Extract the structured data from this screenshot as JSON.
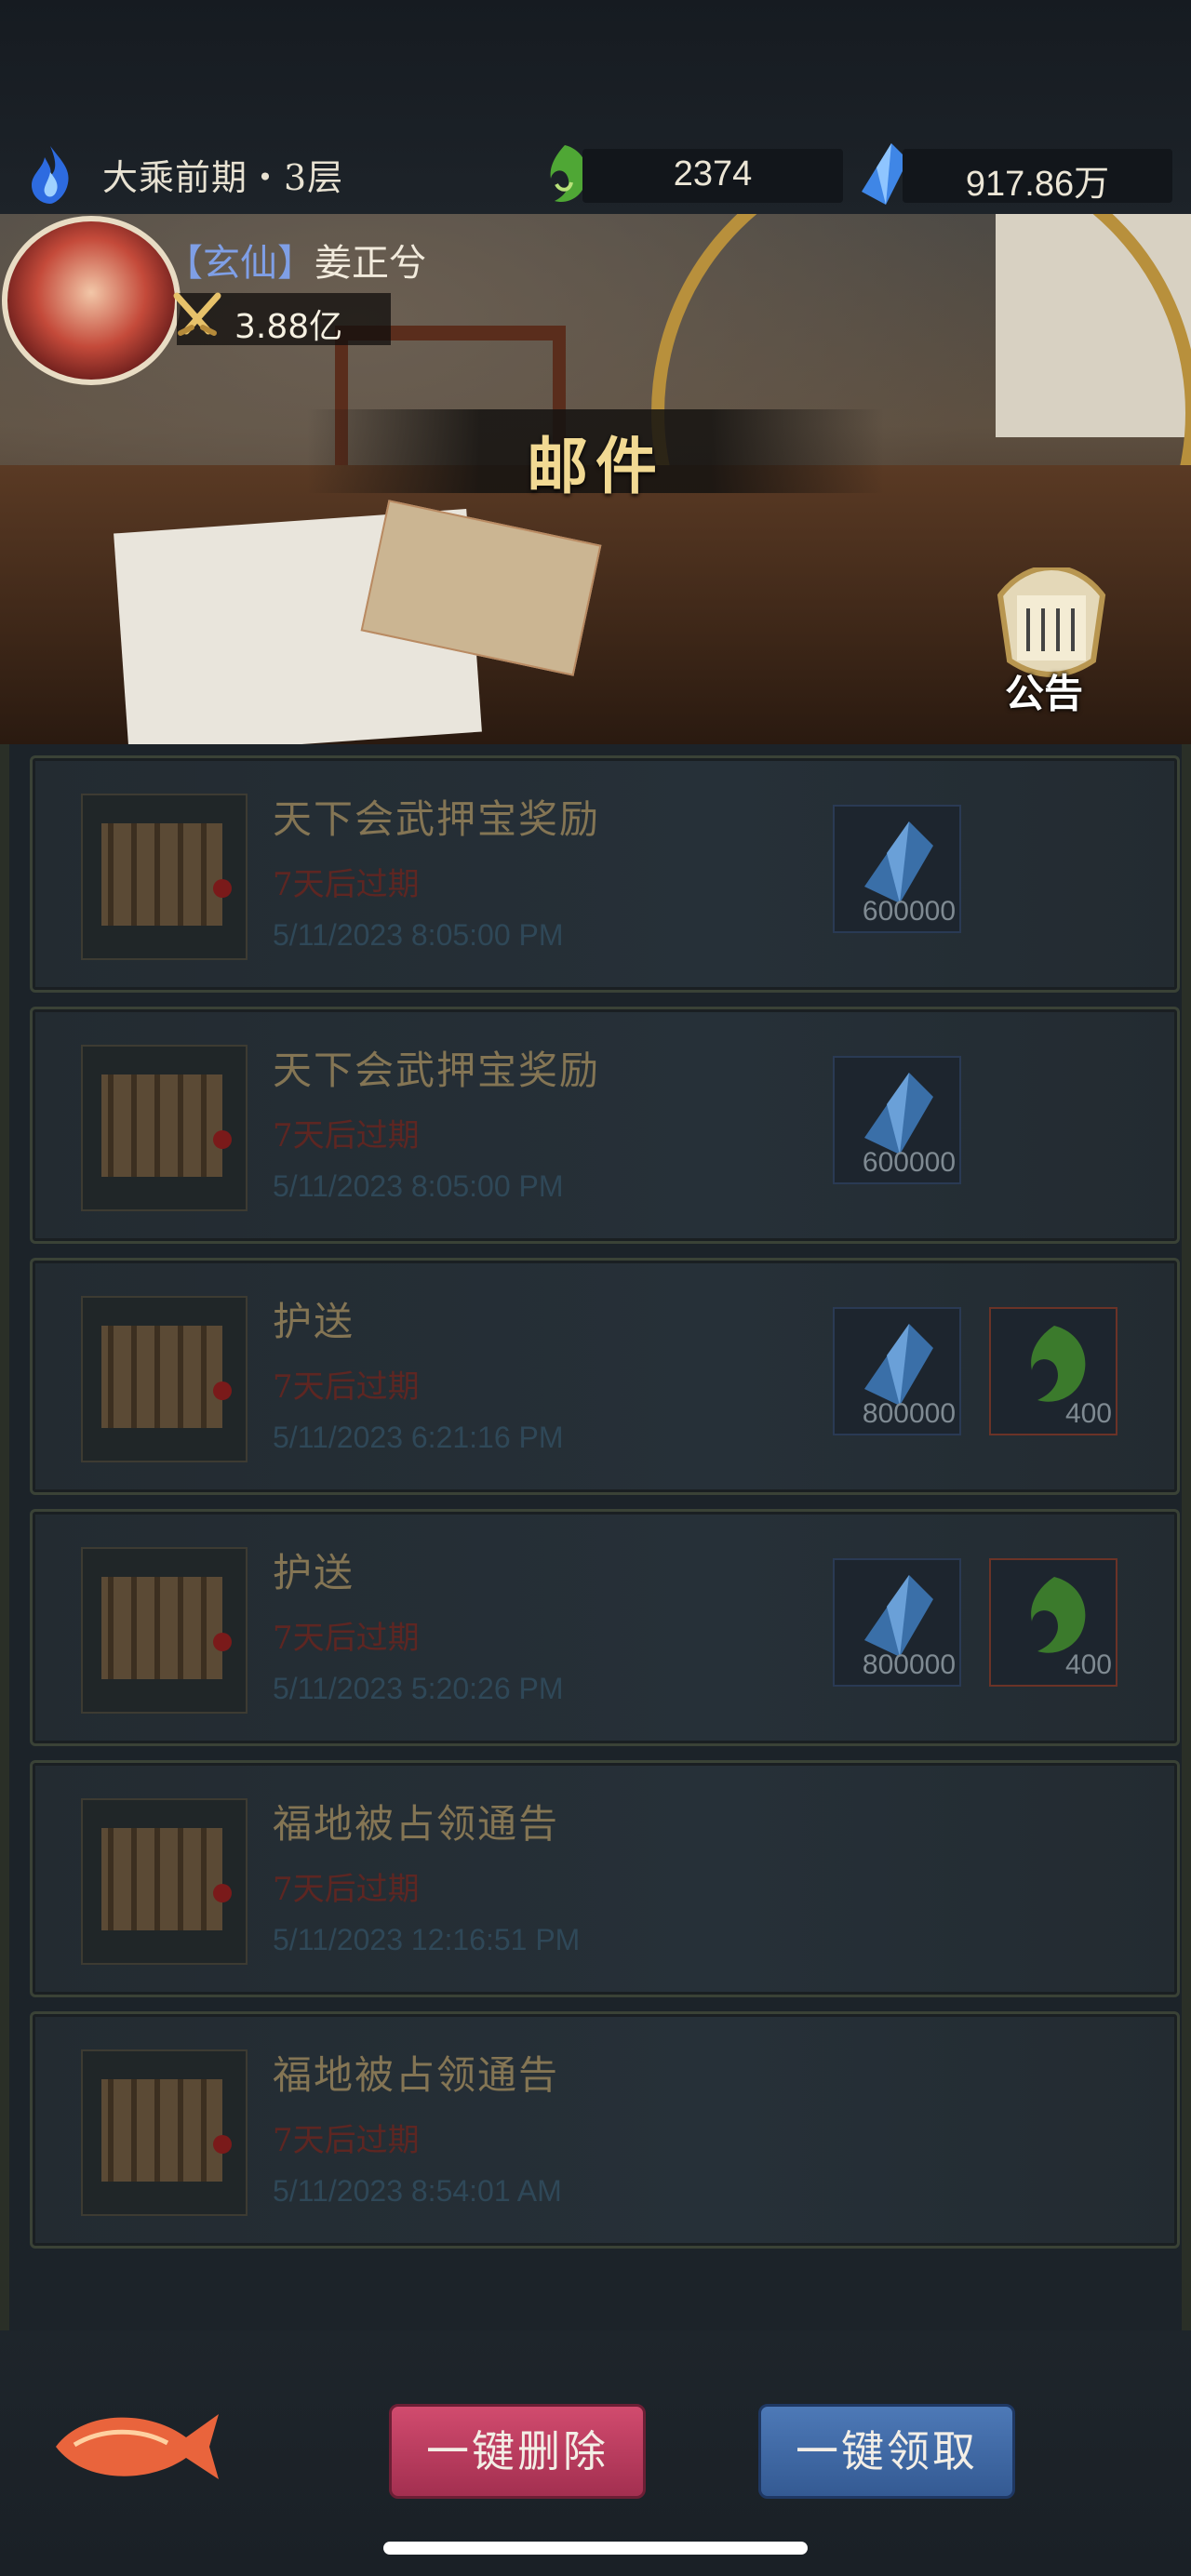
{
  "status": {
    "realm": "大乘前期・3层",
    "jade_currency": "2374",
    "crystal_currency": "917.86万"
  },
  "player": {
    "rank": "【玄仙】",
    "name": "姜正兮",
    "power": "3.88亿"
  },
  "page_title": "邮件",
  "notice_label": "公告",
  "mails": [
    {
      "subject": "天下会武押宝奖励",
      "expire": "7天后过期",
      "date": "5/11/2023 8:05:00 PM",
      "rewards": [
        {
          "type": "crystal",
          "count": "600000"
        }
      ]
    },
    {
      "subject": "天下会武押宝奖励",
      "expire": "7天后过期",
      "date": "5/11/2023 8:05:00 PM",
      "rewards": [
        {
          "type": "crystal",
          "count": "600000"
        }
      ]
    },
    {
      "subject": "护送",
      "expire": "7天后过期",
      "date": "5/11/2023 6:21:16 PM",
      "rewards": [
        {
          "type": "crystal",
          "count": "800000"
        },
        {
          "type": "jade",
          "count": "400"
        }
      ]
    },
    {
      "subject": "护送",
      "expire": "7天后过期",
      "date": "5/11/2023 5:20:26 PM",
      "rewards": [
        {
          "type": "crystal",
          "count": "800000"
        },
        {
          "type": "jade",
          "count": "400"
        }
      ]
    },
    {
      "subject": "福地被占领通告",
      "expire": "7天后过期",
      "date": "5/11/2023 12:16:51 PM",
      "rewards": []
    },
    {
      "subject": "福地被占领通告",
      "expire": "7天后过期",
      "date": "5/11/2023 8:54:01 AM",
      "rewards": []
    }
  ],
  "actions": {
    "delete_all": "一键删除",
    "claim_all": "一键领取"
  },
  "colors": {
    "title_gold": "#f1d993",
    "expire_red": "#5e2622",
    "delete_button": "#c0405f",
    "claim_button": "#4068a5"
  }
}
